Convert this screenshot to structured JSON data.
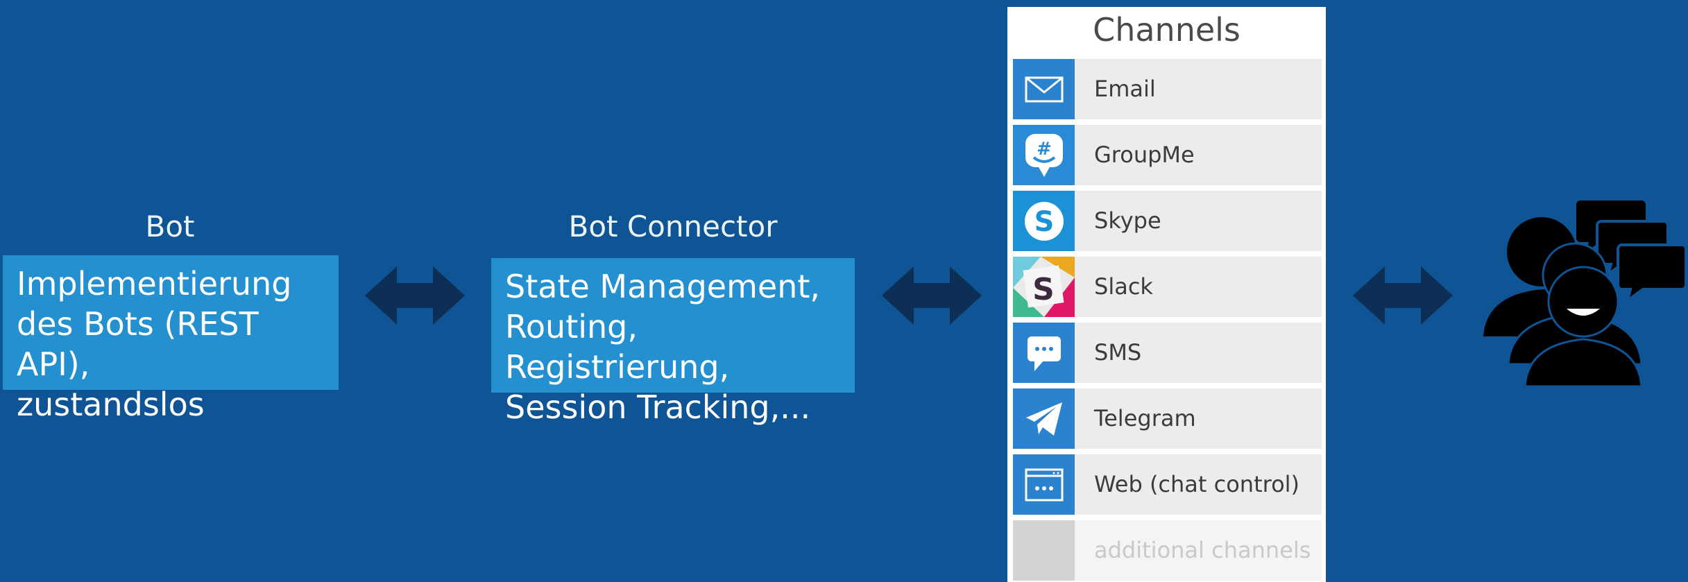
{
  "bot": {
    "label": "Bot",
    "lines": [
      "Implementierung",
      "des Bots (REST API),",
      "zustandslos"
    ]
  },
  "connector": {
    "label": "Bot Connector",
    "lines": [
      "State Management,",
      "Routing, Registrierung,",
      "Session Tracking,..."
    ]
  },
  "channels": {
    "title": "Channels",
    "items": [
      {
        "name": "Email",
        "icon": "email-icon",
        "color": "#2b82cf"
      },
      {
        "name": "GroupMe",
        "icon": "groupme-icon",
        "color": "#2a8ad6"
      },
      {
        "name": "Skype",
        "icon": "skype-icon",
        "color": "#1c92d6"
      },
      {
        "name": "Slack",
        "icon": "slack-icon",
        "color": "#e9e9e9"
      },
      {
        "name": "SMS",
        "icon": "sms-icon",
        "color": "#2b82cf"
      },
      {
        "name": "Telegram",
        "icon": "telegram-icon",
        "color": "#2b82cf"
      },
      {
        "name": "Web (chat control)",
        "icon": "web-chat-icon",
        "color": "#2b82cf"
      },
      {
        "name": "additional channels",
        "icon": "placeholder-icon",
        "color": "#d3d3d3"
      }
    ]
  },
  "colors": {
    "background": "#0f5495",
    "box": "#2490cf",
    "arrow": "#0d2f55",
    "users": "#000000"
  },
  "users_icon": "users-chat-icon"
}
